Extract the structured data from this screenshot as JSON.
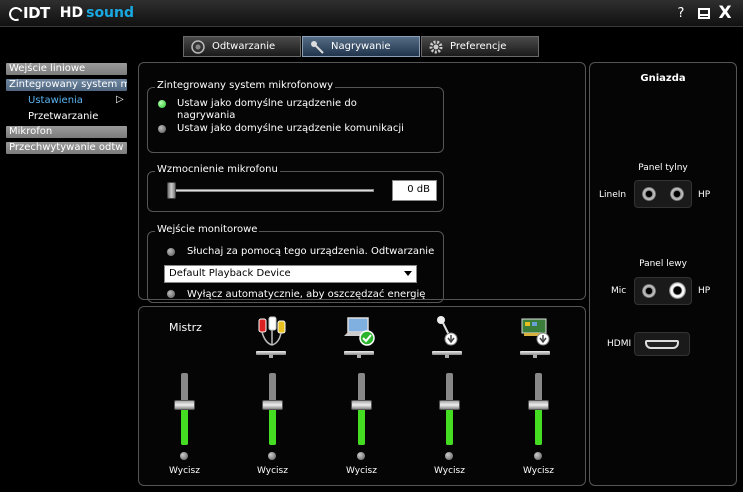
{
  "app": {
    "brand_idt": "IDT",
    "brand_hd": "HD",
    "brand_sound": "sound",
    "help": "?",
    "close": "X",
    "accent_color": "#19a9e2"
  },
  "tabs": [
    {
      "label": "Odtwarzanie",
      "icon": "speaker-icon",
      "active": false
    },
    {
      "label": "Nagrywanie",
      "icon": "microphone-icon",
      "active": true
    },
    {
      "label": "Preferencje",
      "icon": "gear-icon",
      "active": false
    }
  ],
  "sidebar": {
    "items": [
      {
        "label": "Wejście liniowe"
      },
      {
        "label": "Zintegrowany system m",
        "selected": true
      },
      {
        "label": "Mikrofon"
      },
      {
        "label": "Przechwytywanie odtw"
      }
    ],
    "sub_items": [
      {
        "label": "Ustawienia",
        "selected": true
      },
      {
        "label": "Przetwarzanie"
      }
    ]
  },
  "device_group": {
    "title": "Zintegrowany system mikrofonowy",
    "option1": "Ustaw jako domyślne urządzenie do",
    "option1_line2": "nagrywania",
    "option2": "Ustaw jako domyślne urządzenie komunikacji"
  },
  "gain_group": {
    "title": "Wzmocnienie mikrofonu",
    "value": "0 dB",
    "level_fraction": 0
  },
  "monitor_group": {
    "title": "Wejście monitorowe",
    "listen": "Słuchaj za pomocą tego urządzenia. Odtwarzanie",
    "device": "Default Playback Device",
    "auto_off": "Wyłącz automatycznie, aby oszczędzać energię"
  },
  "mixer": {
    "title": "Mistrz",
    "channels": [
      {
        "icon": "master-icon",
        "level": 0.55,
        "mute": "Wycisz"
      },
      {
        "icon": "rca-cable-icon",
        "level": 0.55,
        "mute": "Wycisz"
      },
      {
        "icon": "laptop-check-icon",
        "level": 0.55,
        "mute": "Wycisz"
      },
      {
        "icon": "microphone-stand-icon",
        "level": 0.55,
        "mute": "Wycisz"
      },
      {
        "icon": "sound-card-icon",
        "level": 0.55,
        "mute": "Wycisz"
      }
    ]
  },
  "jacks": {
    "title": "Gniazda",
    "rear_panel": "Panel tylny",
    "rear_left": "LineIn",
    "rear_right": "HP",
    "left_panel": "Panel lewy",
    "left_left": "Mic",
    "left_right": "HP",
    "hdmi": "HDMI"
  }
}
